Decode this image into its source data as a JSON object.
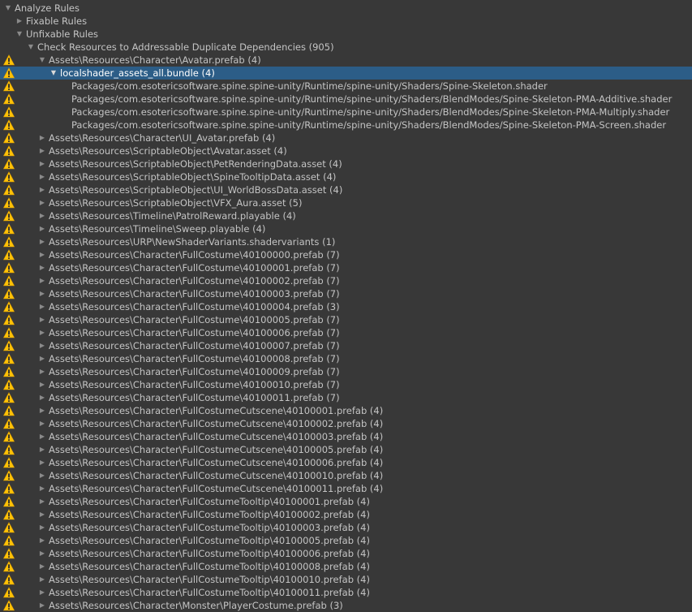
{
  "window_title": "Analyze Rules",
  "rows": [
    {
      "label": "Analyze Rules",
      "level": 0,
      "arrow": "expanded",
      "warn": false,
      "selected": false
    },
    {
      "label": "Fixable Rules",
      "level": 1,
      "arrow": "collapsed",
      "warn": false,
      "selected": false
    },
    {
      "label": "Unfixable Rules",
      "level": 1,
      "arrow": "expanded",
      "warn": false,
      "selected": false
    },
    {
      "label": "Check Resources to Addressable Duplicate Dependencies (905)",
      "level": 2,
      "arrow": "expanded",
      "warn": false,
      "selected": false
    },
    {
      "label": "Assets\\Resources\\Character\\Avatar.prefab (4)",
      "level": 3,
      "arrow": "expanded",
      "warn": true,
      "selected": false
    },
    {
      "label": "localshader_assets_all.bundle (4)",
      "level": 4,
      "arrow": "expanded",
      "warn": true,
      "selected": true
    },
    {
      "label": "Packages/com.esotericsoftware.spine.spine-unity/Runtime/spine-unity/Shaders/Spine-Skeleton.shader",
      "level": 5,
      "arrow": "none",
      "warn": true,
      "selected": false
    },
    {
      "label": "Packages/com.esotericsoftware.spine.spine-unity/Runtime/spine-unity/Shaders/BlendModes/Spine-Skeleton-PMA-Additive.shader",
      "level": 5,
      "arrow": "none",
      "warn": true,
      "selected": false
    },
    {
      "label": "Packages/com.esotericsoftware.spine.spine-unity/Runtime/spine-unity/Shaders/BlendModes/Spine-Skeleton-PMA-Multiply.shader",
      "level": 5,
      "arrow": "none",
      "warn": true,
      "selected": false
    },
    {
      "label": "Packages/com.esotericsoftware.spine.spine-unity/Runtime/spine-unity/Shaders/BlendModes/Spine-Skeleton-PMA-Screen.shader",
      "level": 5,
      "arrow": "none",
      "warn": true,
      "selected": false
    },
    {
      "label": "Assets\\Resources\\Character\\UI_Avatar.prefab (4)",
      "level": 3,
      "arrow": "collapsed",
      "warn": true,
      "selected": false
    },
    {
      "label": "Assets\\Resources\\ScriptableObject\\Avatar.asset (4)",
      "level": 3,
      "arrow": "collapsed",
      "warn": true,
      "selected": false
    },
    {
      "label": "Assets\\Resources\\ScriptableObject\\PetRenderingData.asset (4)",
      "level": 3,
      "arrow": "collapsed",
      "warn": true,
      "selected": false
    },
    {
      "label": "Assets\\Resources\\ScriptableObject\\SpineTooltipData.asset (4)",
      "level": 3,
      "arrow": "collapsed",
      "warn": true,
      "selected": false
    },
    {
      "label": "Assets\\Resources\\ScriptableObject\\UI_WorldBossData.asset (4)",
      "level": 3,
      "arrow": "collapsed",
      "warn": true,
      "selected": false
    },
    {
      "label": "Assets\\Resources\\ScriptableObject\\VFX_Aura.asset (5)",
      "level": 3,
      "arrow": "collapsed",
      "warn": true,
      "selected": false
    },
    {
      "label": "Assets\\Resources\\Timeline\\PatrolReward.playable (4)",
      "level": 3,
      "arrow": "collapsed",
      "warn": true,
      "selected": false
    },
    {
      "label": "Assets\\Resources\\Timeline\\Sweep.playable (4)",
      "level": 3,
      "arrow": "collapsed",
      "warn": true,
      "selected": false
    },
    {
      "label": "Assets\\Resources\\URP\\NewShaderVariants.shadervariants (1)",
      "level": 3,
      "arrow": "collapsed",
      "warn": true,
      "selected": false
    },
    {
      "label": "Assets\\Resources\\Character\\FullCostume\\40100000.prefab (7)",
      "level": 3,
      "arrow": "collapsed",
      "warn": true,
      "selected": false
    },
    {
      "label": "Assets\\Resources\\Character\\FullCostume\\40100001.prefab (7)",
      "level": 3,
      "arrow": "collapsed",
      "warn": true,
      "selected": false
    },
    {
      "label": "Assets\\Resources\\Character\\FullCostume\\40100002.prefab (7)",
      "level": 3,
      "arrow": "collapsed",
      "warn": true,
      "selected": false
    },
    {
      "label": "Assets\\Resources\\Character\\FullCostume\\40100003.prefab (7)",
      "level": 3,
      "arrow": "collapsed",
      "warn": true,
      "selected": false
    },
    {
      "label": "Assets\\Resources\\Character\\FullCostume\\40100004.prefab (3)",
      "level": 3,
      "arrow": "collapsed",
      "warn": true,
      "selected": false
    },
    {
      "label": "Assets\\Resources\\Character\\FullCostume\\40100005.prefab (7)",
      "level": 3,
      "arrow": "collapsed",
      "warn": true,
      "selected": false
    },
    {
      "label": "Assets\\Resources\\Character\\FullCostume\\40100006.prefab (7)",
      "level": 3,
      "arrow": "collapsed",
      "warn": true,
      "selected": false
    },
    {
      "label": "Assets\\Resources\\Character\\FullCostume\\40100007.prefab (7)",
      "level": 3,
      "arrow": "collapsed",
      "warn": true,
      "selected": false
    },
    {
      "label": "Assets\\Resources\\Character\\FullCostume\\40100008.prefab (7)",
      "level": 3,
      "arrow": "collapsed",
      "warn": true,
      "selected": false
    },
    {
      "label": "Assets\\Resources\\Character\\FullCostume\\40100009.prefab (7)",
      "level": 3,
      "arrow": "collapsed",
      "warn": true,
      "selected": false
    },
    {
      "label": "Assets\\Resources\\Character\\FullCostume\\40100010.prefab (7)",
      "level": 3,
      "arrow": "collapsed",
      "warn": true,
      "selected": false
    },
    {
      "label": "Assets\\Resources\\Character\\FullCostume\\40100011.prefab (7)",
      "level": 3,
      "arrow": "collapsed",
      "warn": true,
      "selected": false
    },
    {
      "label": "Assets\\Resources\\Character\\FullCostumeCutscene\\40100001.prefab (4)",
      "level": 3,
      "arrow": "collapsed",
      "warn": true,
      "selected": false
    },
    {
      "label": "Assets\\Resources\\Character\\FullCostumeCutscene\\40100002.prefab (4)",
      "level": 3,
      "arrow": "collapsed",
      "warn": true,
      "selected": false
    },
    {
      "label": "Assets\\Resources\\Character\\FullCostumeCutscene\\40100003.prefab (4)",
      "level": 3,
      "arrow": "collapsed",
      "warn": true,
      "selected": false
    },
    {
      "label": "Assets\\Resources\\Character\\FullCostumeCutscene\\40100005.prefab (4)",
      "level": 3,
      "arrow": "collapsed",
      "warn": true,
      "selected": false
    },
    {
      "label": "Assets\\Resources\\Character\\FullCostumeCutscene\\40100006.prefab (4)",
      "level": 3,
      "arrow": "collapsed",
      "warn": true,
      "selected": false
    },
    {
      "label": "Assets\\Resources\\Character\\FullCostumeCutscene\\40100010.prefab (4)",
      "level": 3,
      "arrow": "collapsed",
      "warn": true,
      "selected": false
    },
    {
      "label": "Assets\\Resources\\Character\\FullCostumeCutscene\\40100011.prefab (4)",
      "level": 3,
      "arrow": "collapsed",
      "warn": true,
      "selected": false
    },
    {
      "label": "Assets\\Resources\\Character\\FullCostumeTooltip\\40100001.prefab (4)",
      "level": 3,
      "arrow": "collapsed",
      "warn": true,
      "selected": false
    },
    {
      "label": "Assets\\Resources\\Character\\FullCostumeTooltip\\40100002.prefab (4)",
      "level": 3,
      "arrow": "collapsed",
      "warn": true,
      "selected": false
    },
    {
      "label": "Assets\\Resources\\Character\\FullCostumeTooltip\\40100003.prefab (4)",
      "level": 3,
      "arrow": "collapsed",
      "warn": true,
      "selected": false
    },
    {
      "label": "Assets\\Resources\\Character\\FullCostumeTooltip\\40100005.prefab (4)",
      "level": 3,
      "arrow": "collapsed",
      "warn": true,
      "selected": false
    },
    {
      "label": "Assets\\Resources\\Character\\FullCostumeTooltip\\40100006.prefab (4)",
      "level": 3,
      "arrow": "collapsed",
      "warn": true,
      "selected": false
    },
    {
      "label": "Assets\\Resources\\Character\\FullCostumeTooltip\\40100008.prefab (4)",
      "level": 3,
      "arrow": "collapsed",
      "warn": true,
      "selected": false
    },
    {
      "label": "Assets\\Resources\\Character\\FullCostumeTooltip\\40100010.prefab (4)",
      "level": 3,
      "arrow": "collapsed",
      "warn": true,
      "selected": false
    },
    {
      "label": "Assets\\Resources\\Character\\FullCostumeTooltip\\40100011.prefab (4)",
      "level": 3,
      "arrow": "collapsed",
      "warn": true,
      "selected": false
    },
    {
      "label": "Assets\\Resources\\Character\\Monster\\PlayerCostume.prefab (3)",
      "level": 3,
      "arrow": "collapsed",
      "warn": true,
      "selected": false
    }
  ]
}
